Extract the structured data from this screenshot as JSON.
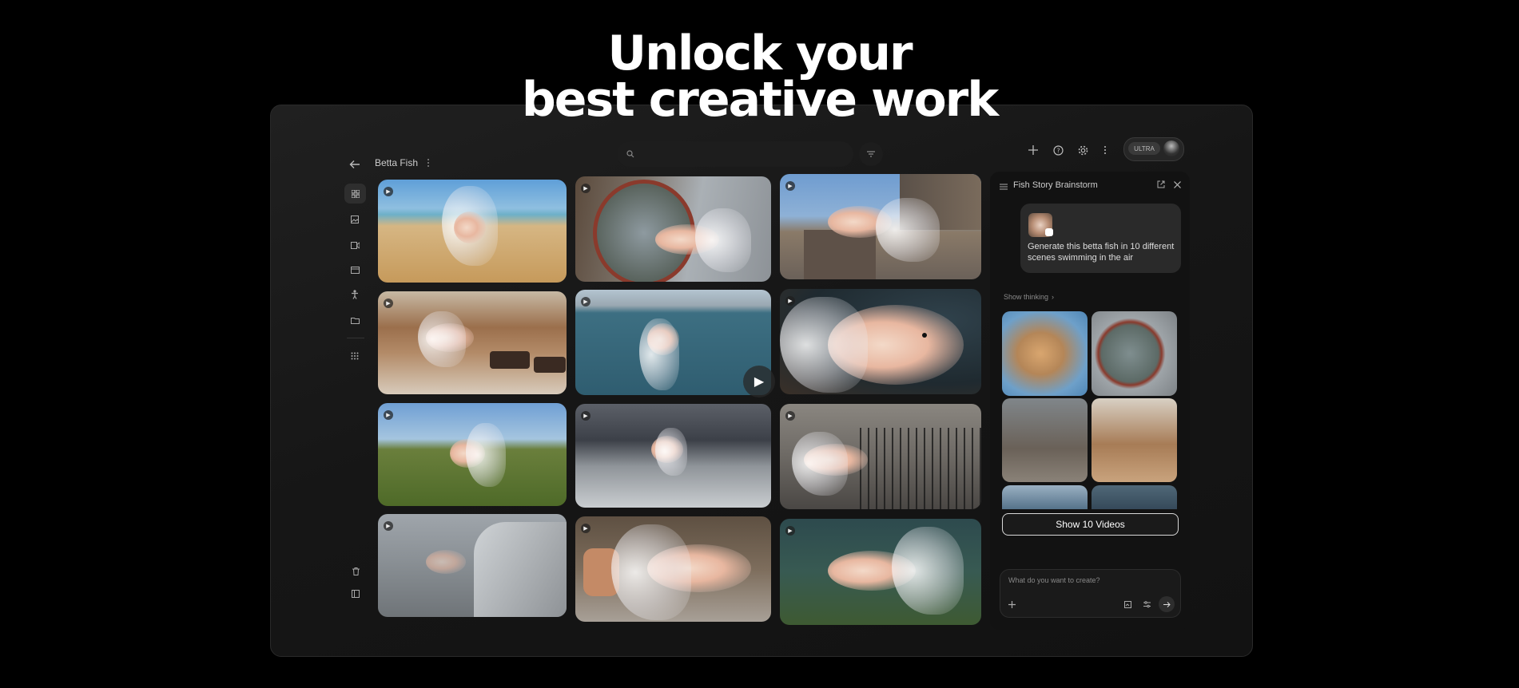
{
  "hero": {
    "line1": "Unlock your",
    "line2": "best creative work"
  },
  "project": {
    "title": "Betta Fish"
  },
  "panel": {
    "title": "Fish Story Brainstorm",
    "user_message": "Generate this betta fish in 10 different scenes swimming in the air",
    "show_thinking": "Show thinking",
    "show_videos_label": "Show 10 Videos",
    "prompt_placeholder": "What do you want to create?"
  },
  "account": {
    "plan_badge": "ULTRA"
  },
  "icons": {
    "back": "arrow-left-icon",
    "more": "more-vertical-icon",
    "search": "search-icon",
    "filter": "filter-icon",
    "add": "plus-icon",
    "help": "help-icon",
    "settings": "gear-icon",
    "menu": "hamburger-icon",
    "external": "open-in-new-icon",
    "close": "close-icon"
  },
  "colors": {
    "background": "#000000",
    "frame": "#181818",
    "panel": "#121212",
    "accent_text": "#ffffff"
  }
}
